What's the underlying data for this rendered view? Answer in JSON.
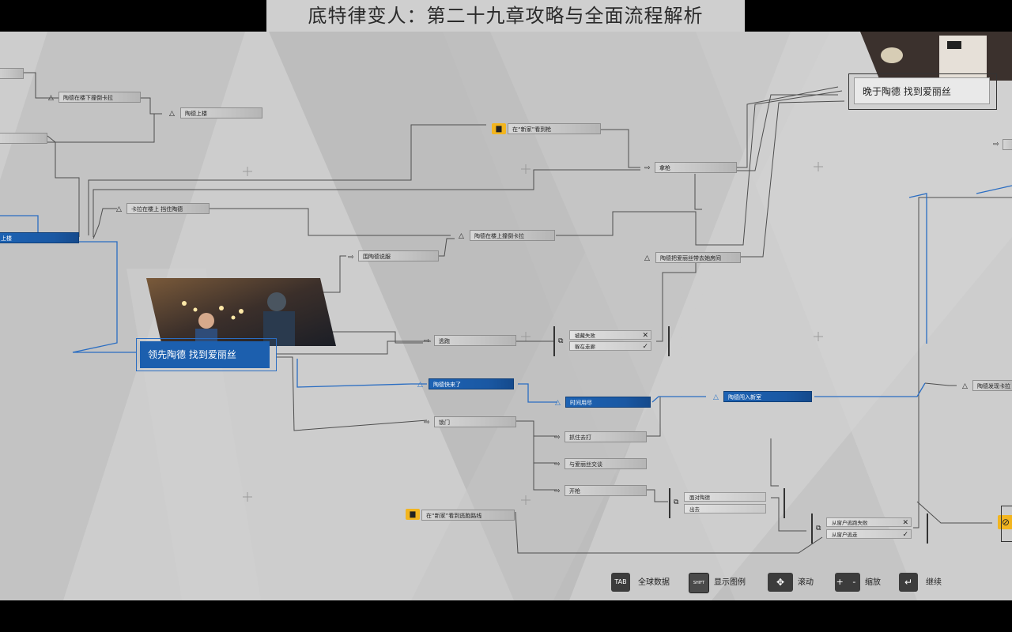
{
  "page_title": "底特律变人：第二十九章攻略与全面流程解析",
  "colors": {
    "accent_blue": "#1d63b4",
    "lock_yellow": "#f2b51f",
    "background": "#cdcdcd"
  },
  "objectives": {
    "lead": "领先陶德 找到爱丽丝",
    "late": "晚于陶德 找到爱丽丝"
  },
  "nodes": {
    "todd_stairs_grab": "陶德在楼下撞倒卡拉",
    "todd_upstairs": "陶德上楼",
    "newhome_gun": "在“新家”看到枪",
    "take_gun": "拿枪",
    "kara_stop_todd": "卡拉在楼上 挡住陶德",
    "upstairs": "上楼",
    "todd_throw_kara": "陶德在楼上撞倒卡拉",
    "todd_reach_room": "陶德把爱丽丝带去她房间",
    "surround_talk": "围陶德说服",
    "escape": "逃跑",
    "todd_coming": "陶德快来了",
    "time_up": "时间用尽",
    "todd_enter_room": "陶德闯入新室",
    "lock_door": "锁门",
    "fight_back": "抓住去打",
    "talk_alice": "与爱丽丝交谈",
    "open_fire": "开枪",
    "newhome_escape_route": "在“新家”看到逃跑路线",
    "todd_find_kara": "陶德发现卡拉"
  },
  "choices": {
    "c1": {
      "label": "被藏失败",
      "mark": "✕"
    },
    "c2": {
      "label": "躲在走廊",
      "mark": "✓"
    },
    "c3": {
      "label": "面对陶德",
      "mark": ""
    },
    "c4": {
      "label": "出去",
      "mark": ""
    },
    "c5": {
      "label": "从窗户逃跑失败",
      "mark": "✕"
    },
    "c6": {
      "label": "从窗户逃走",
      "mark": "✓"
    }
  },
  "legend": {
    "global": {
      "key": "TAB",
      "label": "全球数据"
    },
    "show_legend": {
      "key": "SHIFT",
      "label": "显示图例"
    },
    "scroll": {
      "key": "✥",
      "label": "滚动"
    },
    "zoom": {
      "key": "+ -",
      "label": "缩放"
    },
    "continue": {
      "key": "↵",
      "label": "继续"
    }
  }
}
